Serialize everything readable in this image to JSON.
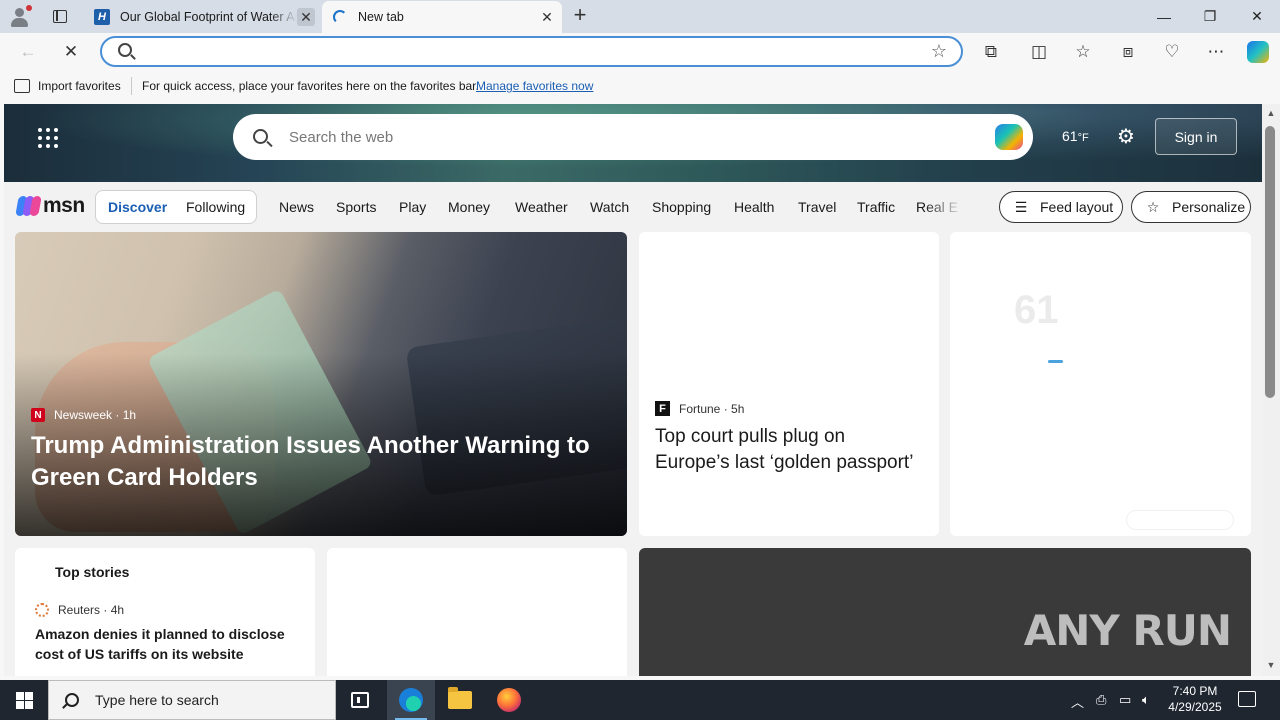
{
  "browser": {
    "tabs": [
      {
        "title": "Our Global Footprint of Water Ar",
        "favicon": "H",
        "active": false
      },
      {
        "title": "New tab",
        "active": true
      }
    ],
    "address_value": "",
    "favorites_bar": {
      "import_label": "Import favorites",
      "message": "For quick access, place your favorites here on the favorites bar.",
      "manage_link": "Manage favorites now"
    }
  },
  "msn": {
    "search_placeholder": "Search the web",
    "weather_temp": "61",
    "weather_unit": "°F",
    "sign_in_label": "Sign in",
    "logo_text": "msn",
    "feed_tabs": {
      "discover": "Discover",
      "following": "Following"
    },
    "nav_items": [
      "News",
      "Sports",
      "Play",
      "Money",
      "Weather",
      "Watch",
      "Shopping",
      "Health",
      "Travel",
      "Traffic",
      "Real E"
    ],
    "feed_layout_label": "Feed layout",
    "personalize_label": "Personalize",
    "cards": {
      "hero": {
        "source": "Newsweek",
        "age": "1h",
        "headline": "Trump Administration Issues Another Warning to Green Card Holders"
      },
      "fortune": {
        "source": "Fortune",
        "age": "5h",
        "headline": "Top court pulls plug on Europe’s last ‘golden passport’"
      },
      "weather_ghost": "61",
      "top_stories": {
        "title": "Top stories",
        "source": "Reuters",
        "age": "4h",
        "headline": "Amazon denies it planned to disclose cost of US tariffs on its website"
      },
      "watermark": "ANY RUN"
    }
  },
  "taskbar": {
    "search_placeholder": "Type here to search",
    "time": "7:40 PM",
    "date": "4/29/2025"
  }
}
